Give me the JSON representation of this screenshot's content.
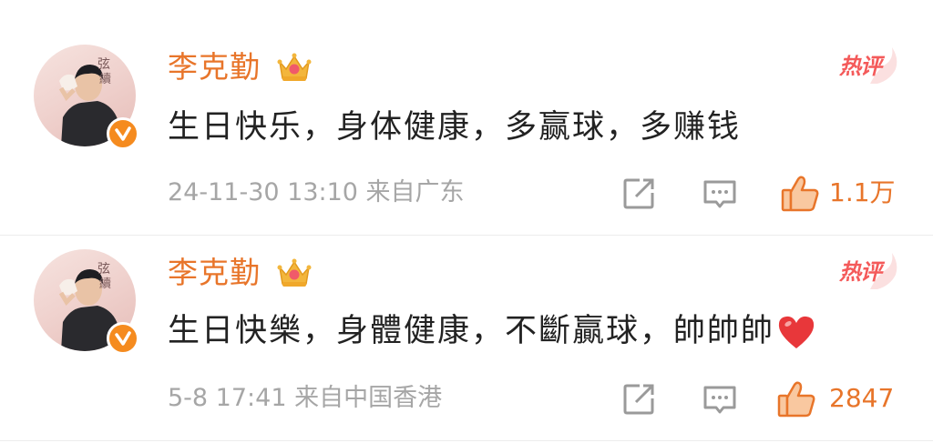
{
  "comments": [
    {
      "username": "李克勤",
      "badge": "热评",
      "text": "生日快乐，身体健康，多赢球，多赚钱",
      "meta": "24-11-30 13:10  来自广东",
      "likes": "1.1万",
      "has_heart_emoji": false
    },
    {
      "username": "李克勤",
      "badge": "热评",
      "text": "生日快樂，身體健康，不斷贏球，帥帥帥",
      "meta": "5-8 17:41  来自中国香港",
      "likes": "2847",
      "has_heart_emoji": true
    }
  ],
  "colors": {
    "accent": "#e8752a",
    "hot_badge": "#f45a5a",
    "meta": "#a6a6a6",
    "text": "#222222",
    "verified": "#f58b1f"
  },
  "icons": [
    "verified-icon",
    "crown-icon",
    "share-icon",
    "reply-icon",
    "like-icon",
    "heart-emoji-icon"
  ]
}
